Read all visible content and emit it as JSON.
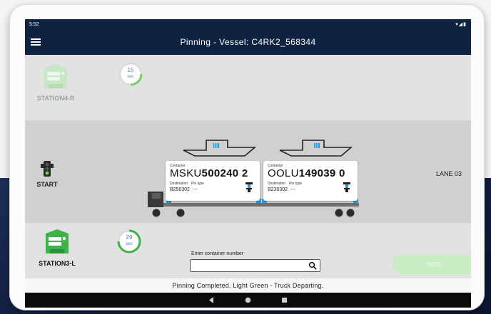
{
  "status_bar": {
    "time": "5:52",
    "right": "▾◢▮"
  },
  "app_bar": {
    "title": "Pinning - Vessel: C4RK2_568344"
  },
  "top_station": {
    "name": "STATION4-R",
    "timer_value": "15",
    "timer_unit": "sec",
    "progress": 0.35
  },
  "bottom_station": {
    "name": "STATION3-L",
    "timer_value": "29",
    "timer_unit": "sec",
    "progress": 0.7
  },
  "signal": {
    "label": "START"
  },
  "lane": "LANE 03",
  "containers": [
    {
      "container_label": "Container",
      "prefix": "MSKU",
      "number": "500240 2",
      "destination_label": "Destination",
      "destination": "B250302",
      "pin_type_label": "Pin type",
      "pin_type": "---"
    },
    {
      "container_label": "Container",
      "prefix": "OOLU",
      "number": "149039 0",
      "destination_label": "Destination",
      "destination": "B230302",
      "pin_type_label": "Pin type",
      "pin_type": "---"
    }
  ],
  "search": {
    "label": "Enter container number",
    "value": "",
    "placeholder": ""
  },
  "safe_button": {
    "label": "SAFE"
  },
  "message": "Pinning Completed. Light Green - Truck Departing.",
  "colors": {
    "appbar": "#0f2341",
    "station_green": "#3db24a",
    "safe_button": "#c9ecc4",
    "accent_blue": "#1f9ee0"
  }
}
